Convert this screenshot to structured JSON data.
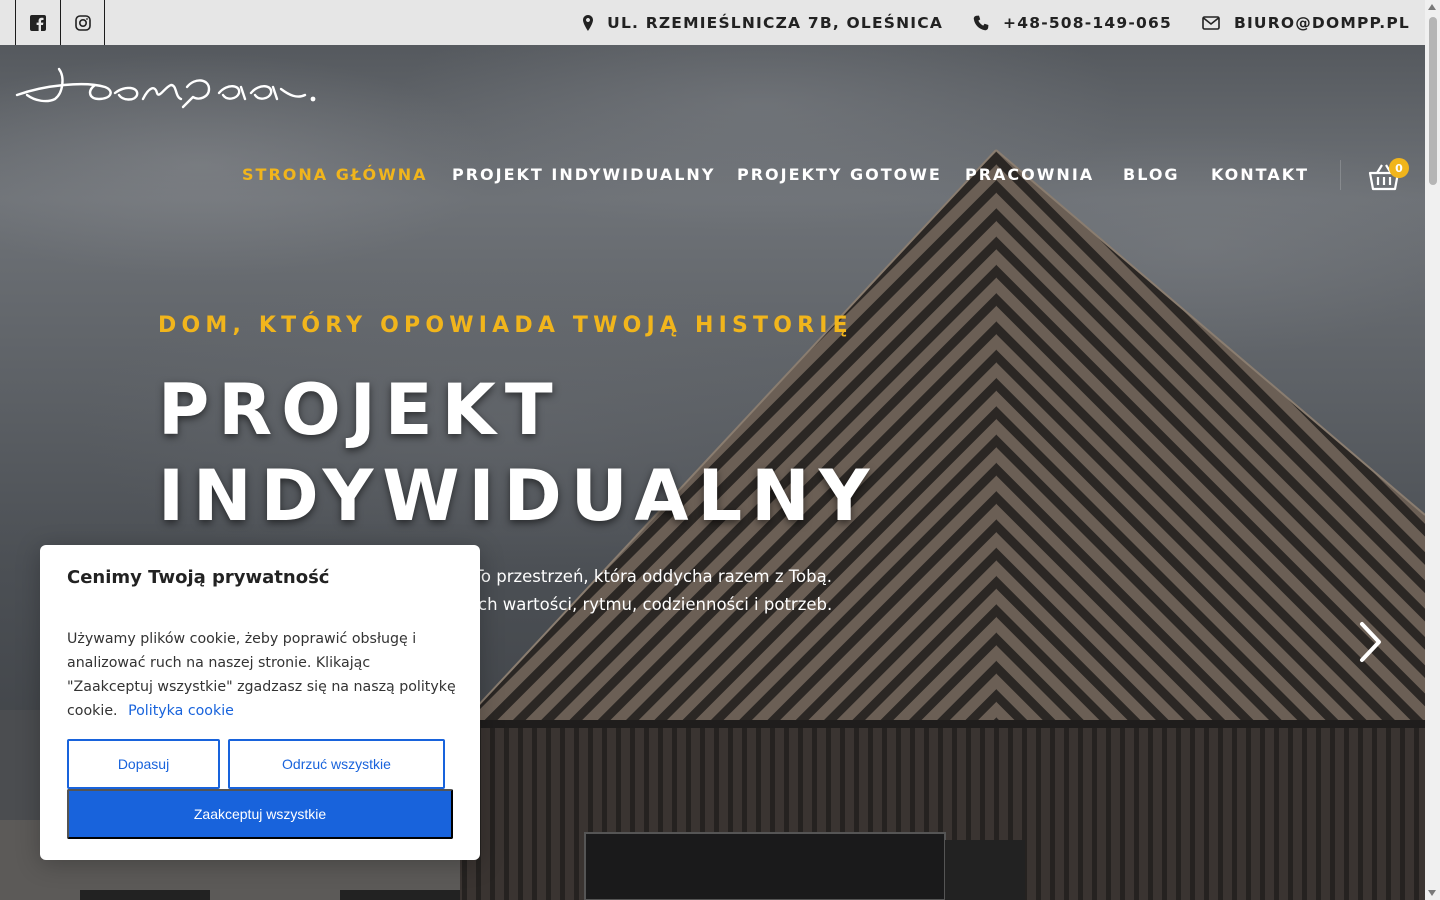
{
  "topbar": {
    "social": [
      {
        "icon": "facebook-icon"
      },
      {
        "icon": "instagram-icon"
      }
    ],
    "address": "UL. RZEMIEŚLNICZA 7B, OLEŚNICA",
    "phone": "+48-508-149-065",
    "email": "BIURO@DOMPP.PL"
  },
  "brand": {
    "logo_text": "dompp."
  },
  "nav": {
    "items": [
      {
        "label": "STRONA GŁÓWNA",
        "active": true
      },
      {
        "label": "PROJEKT INDYWIDUALNY"
      },
      {
        "label": "PROJEKTY GOTOWE"
      },
      {
        "label": "PRACOWNIA"
      },
      {
        "label": "BLOG"
      },
      {
        "label": "KONTAKT"
      }
    ],
    "cart_count": "0"
  },
  "hero": {
    "kicker": "DOM, KTÓRY OPOWIADA TWOJĄ HISTORIĘ",
    "title_line1": "PROJEKT",
    "title_line2": "INDYWIDUALNY",
    "desc_line1": "a. To przestrzeń, która oddycha razem z Tobą.",
    "desc_line2": "ch wartości, rytmu, codzienności i potrzeb."
  },
  "cookie": {
    "title": "Cenimy Twoją prywatność",
    "text": "Używamy plików cookie, żeby poprawić obsługę i analizować ruch na naszej stronie. Klikając \"Zaakceptuj wszystkie\" zgadzasz się na naszą politykę cookie.",
    "link": "Polityka cookie",
    "customize": "Dopasuj",
    "reject": "Odrzuć wszystkie",
    "accept": "Zaakceptuj wszystkie"
  },
  "colors": {
    "accent": "#f1b51c",
    "cookie_blue": "#1863dc",
    "topbar_bg": "#e6e6e6"
  }
}
